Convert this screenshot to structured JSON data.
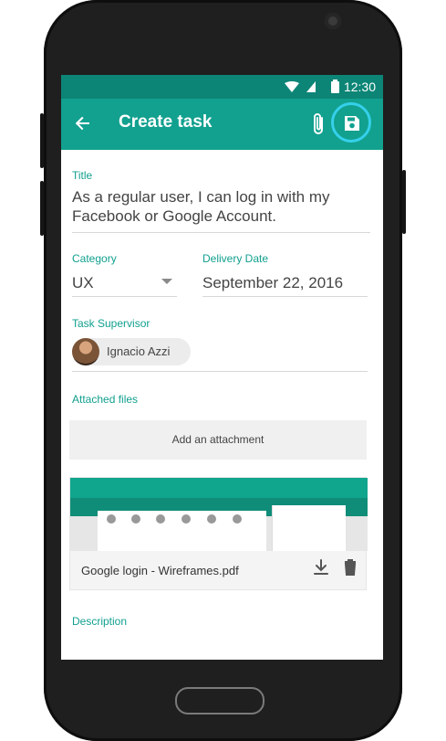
{
  "status": {
    "time": "12:30"
  },
  "header": {
    "title": "Create task"
  },
  "form": {
    "title_label": "Title",
    "title_value": "As a regular user, I can log in with my Facebook or Google Account.",
    "category_label": "Category",
    "category_value": "UX",
    "date_label": "Delivery Date",
    "date_value": "September 22, 2016",
    "supervisor_label": "Task Supervisor",
    "supervisor_name": "Ignacio Azzi",
    "attached_label": "Attached files",
    "add_attachment_label": "Add an attachment",
    "attachment_name": "Google login - Wireframes.pdf",
    "description_label": "Description"
  },
  "icons": {
    "back": "arrow-left",
    "attach": "paperclip",
    "save": "floppy-disk",
    "download": "download-arrow",
    "delete": "trash-can",
    "dropdown": "triangle-down"
  },
  "colors": {
    "primary": "#12a08f",
    "primary_dark": "#0c8576",
    "accent_ring": "#35d0ea",
    "label": "#12a08f"
  }
}
